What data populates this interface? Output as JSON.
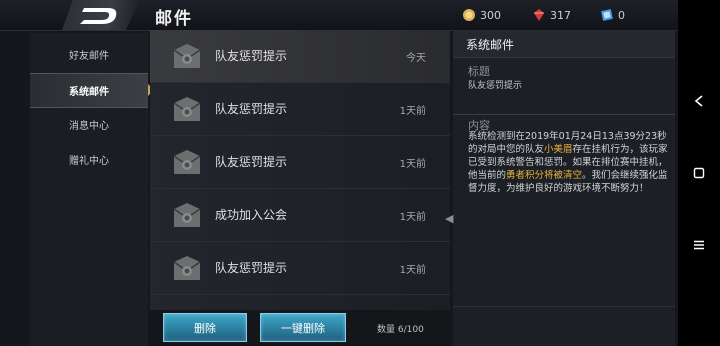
{
  "header": {
    "title": "邮件"
  },
  "resources": [
    {
      "name": "coin",
      "value": "300",
      "color": "#d9b25a",
      "icon": "coin-icon"
    },
    {
      "name": "diamond",
      "value": "317",
      "color": "#d93a3a",
      "icon": "diamond-icon"
    },
    {
      "name": "ticket",
      "value": "0",
      "color": "#4c9be0",
      "icon": "ticket-icon"
    }
  ],
  "sidebar": {
    "items": [
      {
        "label": "好友邮件",
        "active": false
      },
      {
        "label": "系统邮件",
        "active": true
      },
      {
        "label": "消息中心",
        "active": false
      },
      {
        "label": "赠礼中心",
        "active": false
      }
    ]
  },
  "mails": [
    {
      "title": "队友惩罚提示",
      "time": "今天",
      "selected": true
    },
    {
      "title": "队友惩罚提示",
      "time": "1天前",
      "selected": false
    },
    {
      "title": "队友惩罚提示",
      "time": "1天前",
      "selected": false
    },
    {
      "title": "成功加入公会",
      "time": "1天前",
      "selected": false
    },
    {
      "title": "队友惩罚提示",
      "time": "1天前",
      "selected": false
    }
  ],
  "bottom": {
    "delete_label": "删除",
    "delete_all_label": "一键删除",
    "count_label": "数量 6/100"
  },
  "detail": {
    "header": "系统邮件",
    "subject_label": "标题",
    "subject_value": "队友惩罚提示",
    "content_label": "内容",
    "content_parts": [
      "系统检测到在2019年01月24日13点39分23秒的对局中您的队友",
      "小美眉",
      "存在挂机行为，该玩家已受到系统警告和惩罚。如果在排位赛中挂机，他当前的",
      "勇者积分将被清空",
      "。我们会继续强化监督力度，为维护良好的游戏环境不断努力！"
    ],
    "highlight_color": "#e8b23a"
  },
  "navbar": {
    "icons": [
      "back-triangle-icon",
      "home-square-icon",
      "menu-lines-icon"
    ]
  }
}
